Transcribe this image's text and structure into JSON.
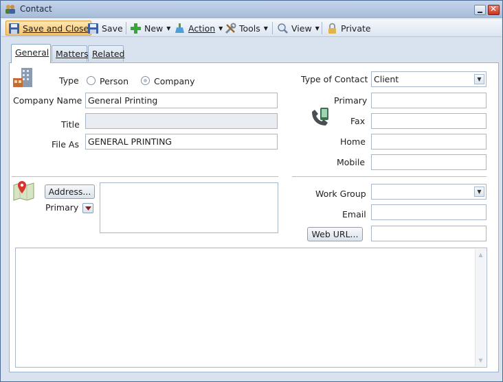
{
  "window": {
    "title": "Contact",
    "icon": "contacts-icon"
  },
  "toolbar": {
    "save_close": "Save and Close",
    "save": "Save",
    "new": "New",
    "action": "Action",
    "tools": "Tools",
    "view": "View",
    "private": "Private"
  },
  "tabs": [
    {
      "label": "General"
    },
    {
      "label": "Matters"
    },
    {
      "label": "Related"
    }
  ],
  "form": {
    "type_label": "Type",
    "type_options": [
      "Person",
      "Company"
    ],
    "type_selected": "Company",
    "company_name_label": "Company Name",
    "company_name": "General Printing",
    "title_label": "Title",
    "title_value": "",
    "file_as_label": "File As",
    "file_as": "GENERAL PRINTING",
    "type_of_contact_label": "Type of Contact",
    "type_of_contact": "Client",
    "primary_label": "Primary",
    "primary_value": "",
    "fax_label": "Fax",
    "fax_value": "",
    "home_label": "Home",
    "home_value": "",
    "mobile_label": "Mobile",
    "mobile_value": "",
    "address_button": "Address...",
    "address_primary_label": "Primary",
    "address_value": "",
    "work_group_label": "Work Group",
    "work_group": "",
    "email_label": "Email",
    "email_value": "",
    "web_url_button": "Web URL...",
    "web_url_value": "",
    "notes": ""
  },
  "colors": {
    "accent": "#f6c46d",
    "window_bg": "#d9e3ef",
    "border": "#9db1cc"
  }
}
